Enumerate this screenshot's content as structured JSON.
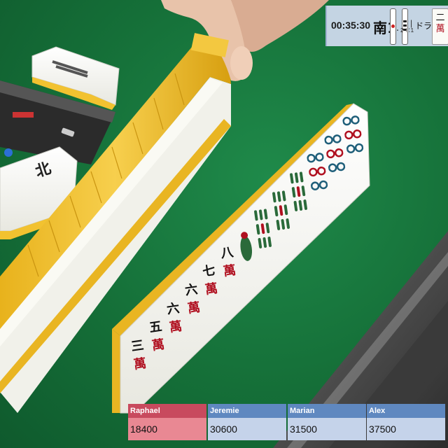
{
  "hud": {
    "timer": "00:35:30",
    "round": "南1",
    "honba_marks": "・2 ∷1",
    "separator": "|",
    "dora_label": "ドラ",
    "dora_tile": {
      "number": "二",
      "suit": "萬"
    }
  },
  "hand_tiles": [
    {
      "number": "三",
      "suit": "萬"
    },
    {
      "number": "五",
      "suit": "萬"
    },
    {
      "number": "六",
      "suit": "萬"
    },
    {
      "number": "六",
      "suit": "萬"
    },
    {
      "number": "七",
      "suit": "萬"
    },
    {
      "number": "八",
      "suit": "萬"
    },
    {
      "icon": "one-bamboo-bird-icon"
    },
    {
      "icon": "bamboo-tile-icon"
    },
    {
      "icon": "bamboo-tile-icon"
    },
    {
      "icon": "bamboo-tile-icon"
    },
    {
      "icon": "pin-circles-tile-icon"
    },
    {
      "icon": "pin-circles-tile-icon"
    },
    {
      "icon": "pin-circles-tile-icon"
    }
  ],
  "upper_left_tiles": {
    "glyphs": "北"
  },
  "colors": {
    "felt": "#156f38",
    "tile_face": "#fbfbf6",
    "tile_back": "#f2c230",
    "active_player": "#c84a5e",
    "player_header": "#5f88c0",
    "player_score_bg": "#c5d3ea"
  },
  "players": [
    {
      "name": "Raphael",
      "score": "18400",
      "active": true
    },
    {
      "name": "Jeremie",
      "score": "30600",
      "active": false
    },
    {
      "name": "Marian",
      "score": "31500",
      "active": false
    },
    {
      "name": "Alex",
      "score": "37500",
      "active": false
    }
  ]
}
